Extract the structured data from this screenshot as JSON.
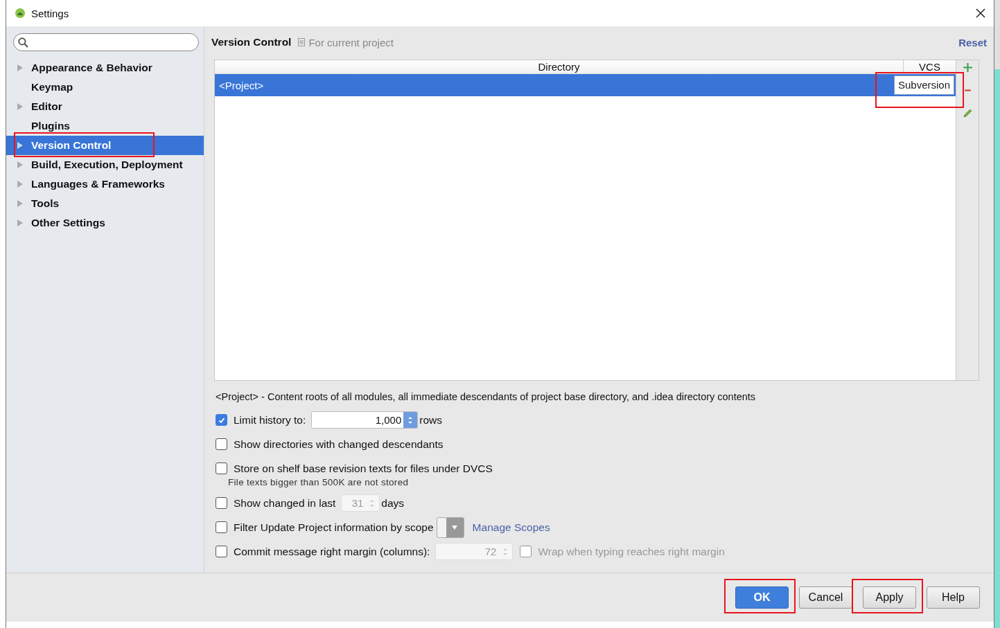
{
  "window": {
    "title": "Settings"
  },
  "sidebar": {
    "items": [
      {
        "label": "Appearance & Behavior",
        "expandable": true,
        "selected": false,
        "highlighted": false
      },
      {
        "label": "Keymap",
        "expandable": false,
        "selected": false,
        "highlighted": false
      },
      {
        "label": "Editor",
        "expandable": true,
        "selected": false,
        "highlighted": false
      },
      {
        "label": "Plugins",
        "expandable": false,
        "selected": false,
        "highlighted": false
      },
      {
        "label": "Version Control",
        "expandable": true,
        "selected": true,
        "highlighted": true
      },
      {
        "label": "Build, Execution, Deployment",
        "expandable": true,
        "selected": false,
        "highlighted": false
      },
      {
        "label": "Languages & Frameworks",
        "expandable": true,
        "selected": false,
        "highlighted": false
      },
      {
        "label": "Tools",
        "expandable": true,
        "selected": false,
        "highlighted": false
      },
      {
        "label": "Other Settings",
        "expandable": true,
        "selected": false,
        "highlighted": false
      }
    ]
  },
  "header": {
    "title": "Version Control",
    "scope": "For current project",
    "reset": "Reset"
  },
  "table": {
    "columns": [
      "Directory",
      "VCS"
    ],
    "rows": [
      {
        "directory": "<Project>",
        "vcs": "Subversion",
        "selected": true,
        "highlighted": true
      }
    ]
  },
  "note": "<Project> - Content roots of all modules, all immediate descendants of project base directory, and .idea directory contents",
  "options": [
    {
      "kind": "number",
      "checked": true,
      "label": "Limit history to:",
      "value": "1,000",
      "suffix": "rows",
      "disabled": false
    },
    {
      "kind": "check",
      "checked": false,
      "label": "Show directories with changed descendants"
    },
    {
      "kind": "check",
      "checked": false,
      "label": "Store on shelf base revision texts for files under DVCS",
      "hint": "File texts bigger than 500K are not stored"
    },
    {
      "kind": "number",
      "checked": false,
      "label": "Show changed in last",
      "value": "31",
      "suffix": "days",
      "disabled": true
    },
    {
      "kind": "scope",
      "checked": false,
      "label": "Filter Update Project information by scope",
      "link": "Manage Scopes"
    },
    {
      "kind": "margin",
      "checked": false,
      "label": "Commit message right margin (columns):",
      "value": "72",
      "disabled": true,
      "wrap": {
        "label": "Wrap when typing reaches right margin",
        "checked": false,
        "disabled": true
      }
    }
  ],
  "buttons": [
    {
      "label": "OK",
      "primary": true,
      "highlighted": true
    },
    {
      "label": "Cancel",
      "primary": false,
      "highlighted": false
    },
    {
      "label": "Apply",
      "primary": false,
      "highlighted": true
    },
    {
      "label": "Help",
      "primary": false,
      "highlighted": false
    }
  ]
}
